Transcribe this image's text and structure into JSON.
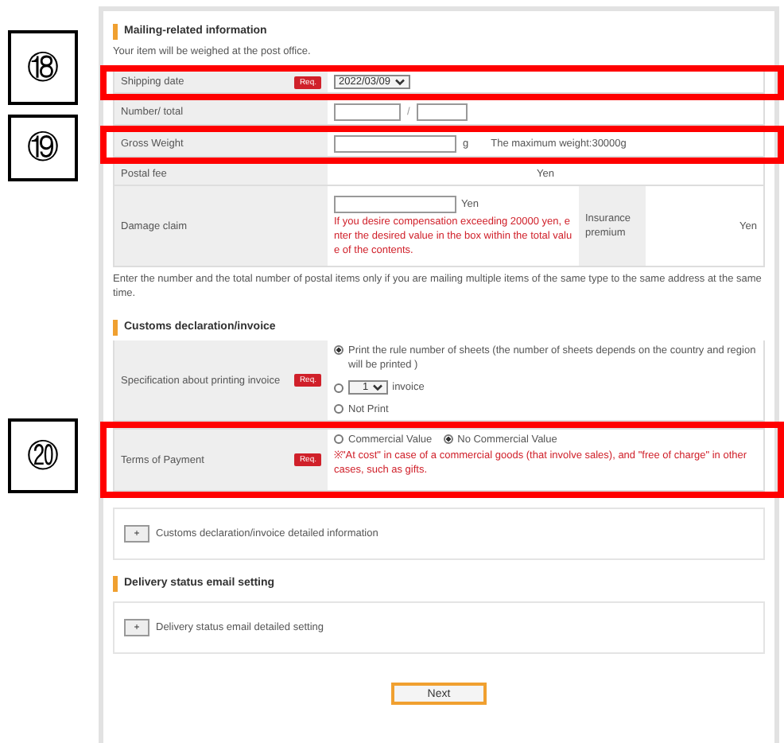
{
  "mailing": {
    "title": "Mailing-related information",
    "note": "Your item will be weighed at the post office.",
    "shipping_date": {
      "label": "Shipping date",
      "required": "Req.",
      "value": "2022/03/09",
      "highlighted": true,
      "callout": "⑱"
    },
    "number_total": {
      "label": "Number/ total",
      "separator": "/"
    },
    "gross_weight": {
      "label": "Gross Weight",
      "unit": "g",
      "hint": "The maximum weight:30000g",
      "highlighted": true,
      "callout": "⑲"
    },
    "postal_fee": {
      "label": "Postal fee",
      "unit": "Yen"
    },
    "damage_claim": {
      "label": "Damage claim",
      "unit": "Yen",
      "warning": "If you desire compensation exceeding 20000 yen, enter the desired value in the box within the total value of the contents.",
      "insurance_label": "Insurance premium",
      "insurance_unit": "Yen"
    },
    "footnote": "Enter the number and the total number of postal items only if you are mailing multiple items of the same type to the same address at the same time."
  },
  "customs": {
    "title": "Customs declaration/invoice",
    "specification": {
      "label": "Specification about printing invoice",
      "required": "Req.",
      "options": [
        {
          "kind": "text",
          "label": "Print the rule number of sheets (the number of sheets depends on the country and region will be printed )",
          "selected": true
        },
        {
          "kind": "select",
          "value": "1",
          "label": "invoice",
          "selected": false
        },
        {
          "kind": "text",
          "label": "Not Print",
          "selected": false
        }
      ]
    },
    "terms": {
      "label": "Terms of Payment",
      "required": "Req.",
      "highlighted": true,
      "callout": "⑳",
      "options": [
        {
          "label": "Commercial Value",
          "selected": false
        },
        {
          "label": "No Commercial Value",
          "selected": true
        }
      ],
      "warning": "※\"At cost\" in case of a commercial goods (that involve sales), and \"free of charge\" in other cases, such as gifts."
    },
    "detail": {
      "toggle": "+",
      "label": "Customs declaration/invoice detailed information"
    }
  },
  "delivery": {
    "title": "Delivery status email setting",
    "detail": {
      "toggle": "+",
      "label": "Delivery status email detailed setting"
    }
  },
  "next_button": "Next"
}
